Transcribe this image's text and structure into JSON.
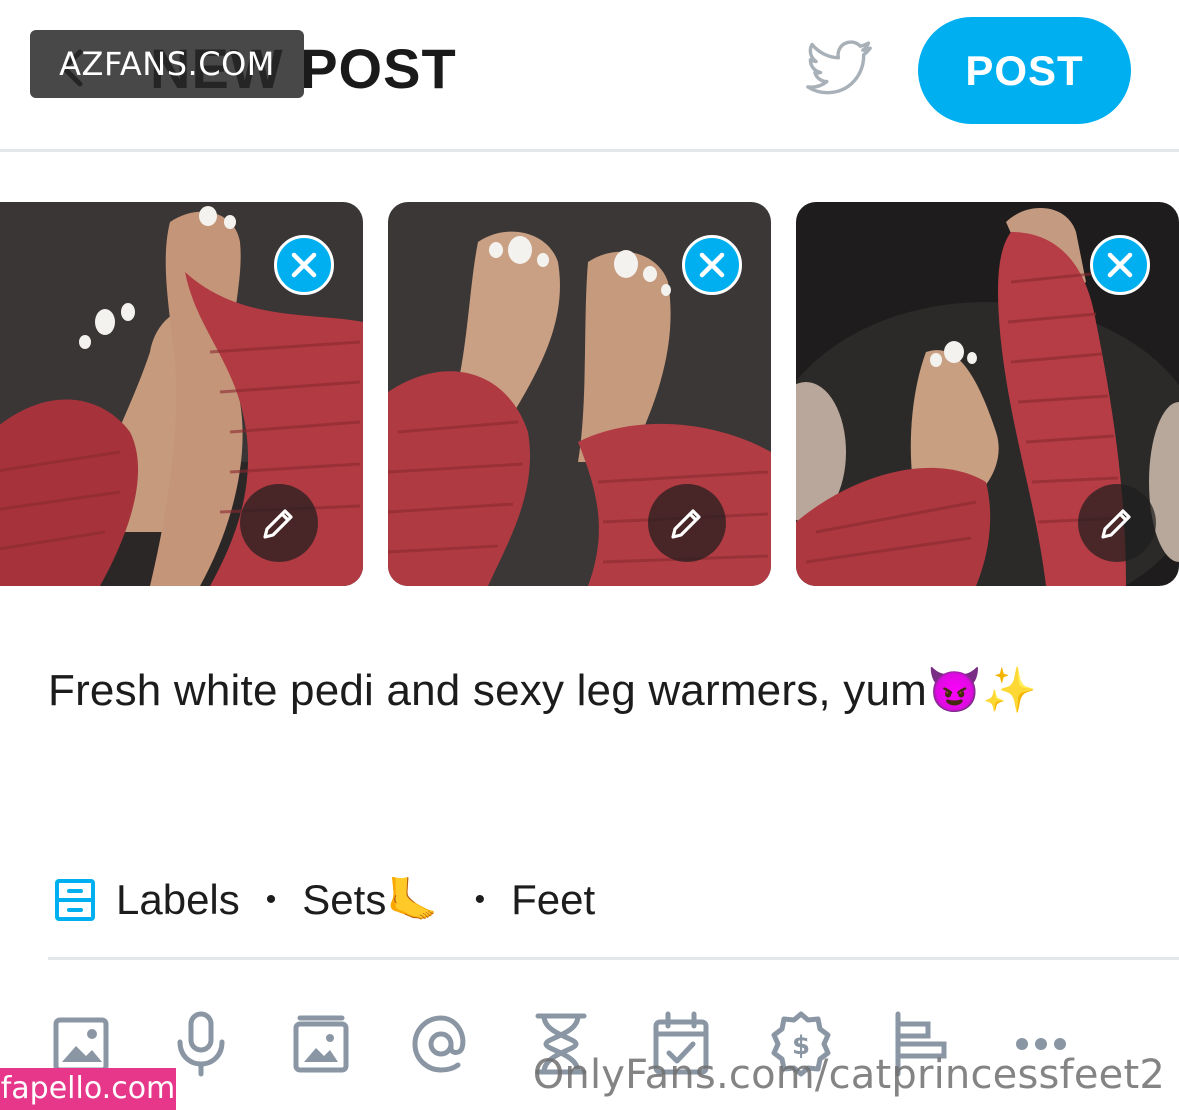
{
  "header": {
    "title": "NEW POST",
    "post_button": "POST",
    "back_icon": "chevron-left-icon",
    "twitter_icon": "twitter-bird-icon"
  },
  "media": [
    {
      "remove_icon": "close-icon",
      "edit_icon": "pencil-icon"
    },
    {
      "remove_icon": "close-icon",
      "edit_icon": "pencil-icon"
    },
    {
      "remove_icon": "close-icon",
      "edit_icon": "pencil-icon"
    }
  ],
  "caption": {
    "text": "Fresh white pedi and sexy leg warmers, yum😈✨"
  },
  "labels": {
    "icon": "drawer-icon",
    "items": [
      "Labels",
      "Sets🦶",
      "Feet"
    ],
    "separator": "•"
  },
  "toolbar": {
    "icons": [
      "image-icon",
      "microphone-icon",
      "vault-icon",
      "at-sign-icon",
      "hourglass-icon",
      "calendar-check-icon",
      "price-tag-icon",
      "poll-icon",
      "more-icon"
    ]
  },
  "watermarks": {
    "top_left": "AZFANS.COM",
    "bottom_left": "fapello.com",
    "bottom_right": "OnlyFans.com/catprincessfeet2"
  },
  "colors": {
    "accent": "#00aff0",
    "icon_gray": "#8a96a3",
    "divider": "#e3e6ea"
  }
}
